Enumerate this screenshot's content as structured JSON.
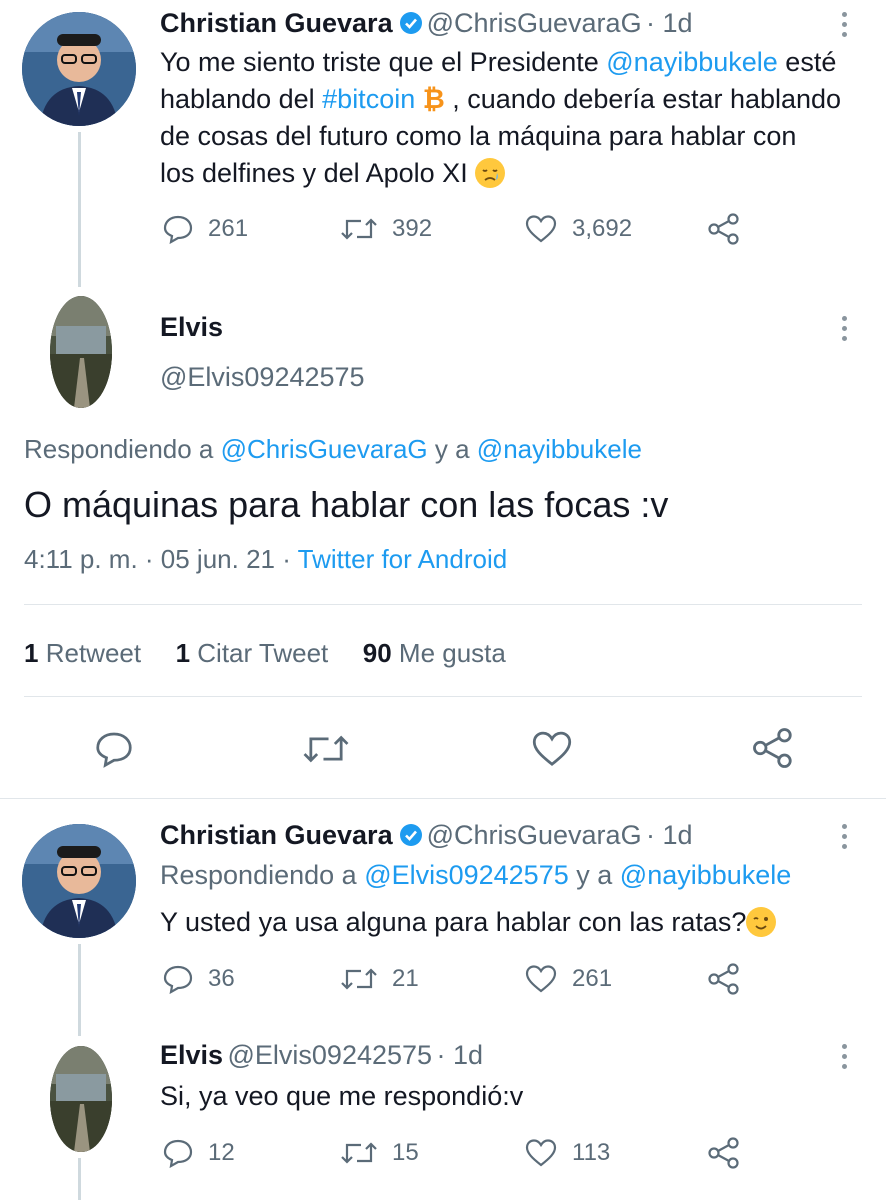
{
  "tweet1": {
    "name": "Christian Guevara",
    "handle": "@ChrisGuevaraG",
    "time": "· 1d",
    "line1_pre": "Yo me siento triste que el Presidente ",
    "line1_mention": "@nayibbukele",
    "line1_post": " esté",
    "line2_pre": "hablando del ",
    "line2_hashtag": "#bitcoin",
    "btc_symbol": "₿",
    "line2_post": " , cuando debería estar hablando",
    "line3": "de cosas del futuro como la máquina para hablar con",
    "line4": "los delfines y del Apolo XI",
    "replies": "261",
    "retweets": "392",
    "likes": "3,692"
  },
  "main": {
    "name": "Elvis",
    "handle": "@Elvis09242575",
    "replying_label": "Respondiendo a",
    "replying_to_1": "@ChrisGuevaraG",
    "replying_and": "y a",
    "replying_to_2": "@nayibbukele",
    "text": "O máquinas para hablar con las focas :v",
    "timestamp": "4:11 p. m. · 05 jun. 21 ·",
    "client": "Twitter for Android",
    "retweet_count": "1",
    "retweet_label": "Retweet",
    "quote_count": "1",
    "quote_label": "Citar Tweet",
    "like_count": "90",
    "like_label": "Me gusta"
  },
  "reply1": {
    "name": "Christian Guevara",
    "handle": "@ChrisGuevaraG",
    "time": "· 1d",
    "replying_label": "Respondiendo a",
    "replying_to_1": "@Elvis09242575",
    "replying_and": "y a",
    "replying_to_2": "@nayibbukele",
    "text": "Y usted ya usa alguna para hablar con las ratas?",
    "replies": "36",
    "retweets": "21",
    "likes": "261"
  },
  "reply2": {
    "name": "Elvis",
    "handle": "@Elvis09242575",
    "time": "· 1d",
    "text": "Si, ya veo que me respondió:v",
    "replies": "12",
    "retweets": "15",
    "likes": "113"
  },
  "colors": {
    "link": "#1d9bf0",
    "muted": "#5b6b78",
    "verified": "#1d9bf0",
    "bitcoin": "#f7931a"
  }
}
